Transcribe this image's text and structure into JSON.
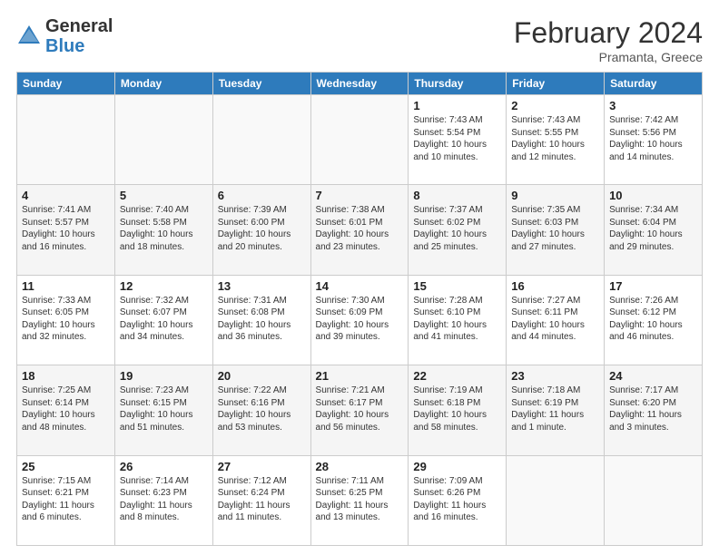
{
  "header": {
    "logo_general": "General",
    "logo_blue": "Blue",
    "month_title": "February 2024",
    "subtitle": "Pramanta, Greece"
  },
  "days_of_week": [
    "Sunday",
    "Monday",
    "Tuesday",
    "Wednesday",
    "Thursday",
    "Friday",
    "Saturday"
  ],
  "weeks": [
    [
      {
        "day": "",
        "info": ""
      },
      {
        "day": "",
        "info": ""
      },
      {
        "day": "",
        "info": ""
      },
      {
        "day": "",
        "info": ""
      },
      {
        "day": "1",
        "info": "Sunrise: 7:43 AM\nSunset: 5:54 PM\nDaylight: 10 hours and 10 minutes."
      },
      {
        "day": "2",
        "info": "Sunrise: 7:43 AM\nSunset: 5:55 PM\nDaylight: 10 hours and 12 minutes."
      },
      {
        "day": "3",
        "info": "Sunrise: 7:42 AM\nSunset: 5:56 PM\nDaylight: 10 hours and 14 minutes."
      }
    ],
    [
      {
        "day": "4",
        "info": "Sunrise: 7:41 AM\nSunset: 5:57 PM\nDaylight: 10 hours and 16 minutes."
      },
      {
        "day": "5",
        "info": "Sunrise: 7:40 AM\nSunset: 5:58 PM\nDaylight: 10 hours and 18 minutes."
      },
      {
        "day": "6",
        "info": "Sunrise: 7:39 AM\nSunset: 6:00 PM\nDaylight: 10 hours and 20 minutes."
      },
      {
        "day": "7",
        "info": "Sunrise: 7:38 AM\nSunset: 6:01 PM\nDaylight: 10 hours and 23 minutes."
      },
      {
        "day": "8",
        "info": "Sunrise: 7:37 AM\nSunset: 6:02 PM\nDaylight: 10 hours and 25 minutes."
      },
      {
        "day": "9",
        "info": "Sunrise: 7:35 AM\nSunset: 6:03 PM\nDaylight: 10 hours and 27 minutes."
      },
      {
        "day": "10",
        "info": "Sunrise: 7:34 AM\nSunset: 6:04 PM\nDaylight: 10 hours and 29 minutes."
      }
    ],
    [
      {
        "day": "11",
        "info": "Sunrise: 7:33 AM\nSunset: 6:05 PM\nDaylight: 10 hours and 32 minutes."
      },
      {
        "day": "12",
        "info": "Sunrise: 7:32 AM\nSunset: 6:07 PM\nDaylight: 10 hours and 34 minutes."
      },
      {
        "day": "13",
        "info": "Sunrise: 7:31 AM\nSunset: 6:08 PM\nDaylight: 10 hours and 36 minutes."
      },
      {
        "day": "14",
        "info": "Sunrise: 7:30 AM\nSunset: 6:09 PM\nDaylight: 10 hours and 39 minutes."
      },
      {
        "day": "15",
        "info": "Sunrise: 7:28 AM\nSunset: 6:10 PM\nDaylight: 10 hours and 41 minutes."
      },
      {
        "day": "16",
        "info": "Sunrise: 7:27 AM\nSunset: 6:11 PM\nDaylight: 10 hours and 44 minutes."
      },
      {
        "day": "17",
        "info": "Sunrise: 7:26 AM\nSunset: 6:12 PM\nDaylight: 10 hours and 46 minutes."
      }
    ],
    [
      {
        "day": "18",
        "info": "Sunrise: 7:25 AM\nSunset: 6:14 PM\nDaylight: 10 hours and 48 minutes."
      },
      {
        "day": "19",
        "info": "Sunrise: 7:23 AM\nSunset: 6:15 PM\nDaylight: 10 hours and 51 minutes."
      },
      {
        "day": "20",
        "info": "Sunrise: 7:22 AM\nSunset: 6:16 PM\nDaylight: 10 hours and 53 minutes."
      },
      {
        "day": "21",
        "info": "Sunrise: 7:21 AM\nSunset: 6:17 PM\nDaylight: 10 hours and 56 minutes."
      },
      {
        "day": "22",
        "info": "Sunrise: 7:19 AM\nSunset: 6:18 PM\nDaylight: 10 hours and 58 minutes."
      },
      {
        "day": "23",
        "info": "Sunrise: 7:18 AM\nSunset: 6:19 PM\nDaylight: 11 hours and 1 minute."
      },
      {
        "day": "24",
        "info": "Sunrise: 7:17 AM\nSunset: 6:20 PM\nDaylight: 11 hours and 3 minutes."
      }
    ],
    [
      {
        "day": "25",
        "info": "Sunrise: 7:15 AM\nSunset: 6:21 PM\nDaylight: 11 hours and 6 minutes."
      },
      {
        "day": "26",
        "info": "Sunrise: 7:14 AM\nSunset: 6:23 PM\nDaylight: 11 hours and 8 minutes."
      },
      {
        "day": "27",
        "info": "Sunrise: 7:12 AM\nSunset: 6:24 PM\nDaylight: 11 hours and 11 minutes."
      },
      {
        "day": "28",
        "info": "Sunrise: 7:11 AM\nSunset: 6:25 PM\nDaylight: 11 hours and 13 minutes."
      },
      {
        "day": "29",
        "info": "Sunrise: 7:09 AM\nSunset: 6:26 PM\nDaylight: 11 hours and 16 minutes."
      },
      {
        "day": "",
        "info": ""
      },
      {
        "day": "",
        "info": ""
      }
    ]
  ]
}
